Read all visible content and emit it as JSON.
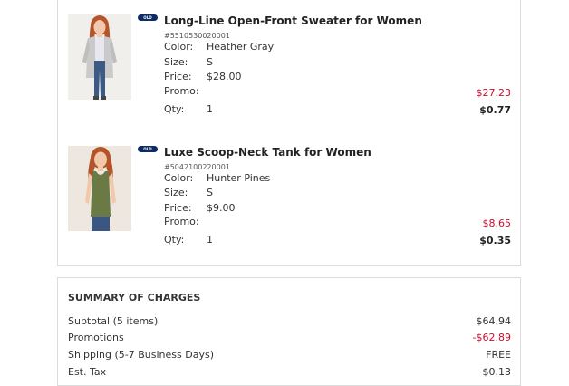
{
  "items": [
    {
      "badge": "OLD NAVY",
      "name": "Long-Line Open-Front Sweater for Women",
      "sku": "#5510530020001",
      "color_label": "Color:",
      "color": "Heather Gray",
      "size_label": "Size:",
      "size": "S",
      "price_label": "Price:",
      "price": "$28.00",
      "promo_label": "Promo:",
      "promo": "$27.23",
      "qty_label": "Qty:",
      "qty": "1",
      "total": "$0.77",
      "image_icon": "sweater-product-photo"
    },
    {
      "badge": "OLD NAVY",
      "name": "Luxe Scoop-Neck Tank for Women",
      "sku": "#5042100220001",
      "color_label": "Color:",
      "color": "Hunter Pines",
      "size_label": "Size:",
      "size": "S",
      "price_label": "Price:",
      "price": "$9.00",
      "promo_label": "Promo:",
      "promo": "$8.65",
      "qty_label": "Qty:",
      "qty": "1",
      "total": "$0.35",
      "image_icon": "tank-top-product-photo"
    }
  ],
  "summary": {
    "title": "SUMMARY OF CHARGES",
    "rows": [
      {
        "label": "Subtotal (5 items)",
        "value": "$64.94"
      },
      {
        "label": "Promotions",
        "value": "-$62.89"
      },
      {
        "label": "Shipping (5-7 Business Days)",
        "value": "FREE"
      },
      {
        "label": "Est. Tax",
        "value": "$0.13"
      }
    ]
  },
  "colors": {
    "promo_red": "#c8102e",
    "brand_navy": "#0e2c63",
    "border": "#dcdcdc",
    "sweater": "#c9cac9",
    "tank": "#6b7a45"
  }
}
